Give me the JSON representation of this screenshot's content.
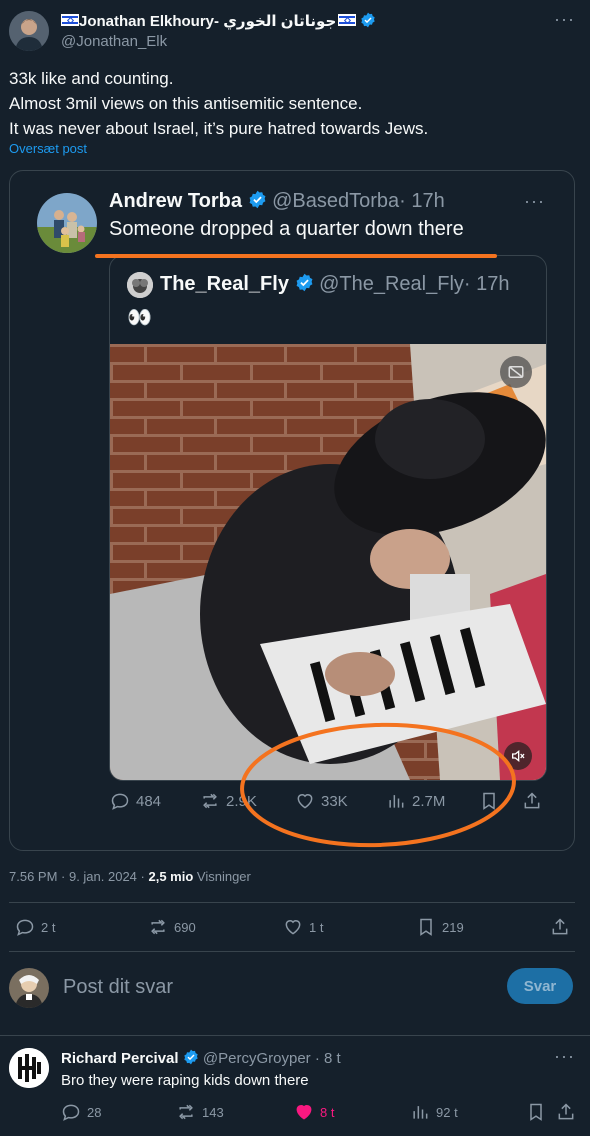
{
  "main_post": {
    "author_name": "Jonathan Elkhoury- جوناتان الخوري",
    "handle": "@Jonathan_Elk",
    "text_lines": [
      "33k like and counting.",
      "Almost 3mil views on this antisemitic sentence.",
      "It was never about Israel, it’s pure hatred towards Jews."
    ],
    "translate_label": "Oversæt post",
    "meta_time": "7.56 PM · 9. jan. 2024 ·",
    "meta_views_count": "2,5 mio",
    "meta_views_label": "Visninger",
    "actions": {
      "replies": "2 t",
      "reposts": "690",
      "likes": "1 t",
      "bookmarks": "219"
    }
  },
  "quoted_post": {
    "author_name": "Andrew Torba",
    "handle": "@BasedTorba",
    "time": "· 17h",
    "text": "Someone dropped a quarter down there",
    "inner_quote": {
      "author_name": "The_Real_Fly",
      "handle": "@The_Real_Fly",
      "time": "· 17h",
      "text": "👀"
    },
    "actions": {
      "replies": "484",
      "reposts": "2.9K",
      "likes": "33K",
      "views": "2.7M"
    }
  },
  "reply_box": {
    "placeholder": "Post dit svar",
    "button_label": "Svar"
  },
  "reply": {
    "author_name": "Richard Percival",
    "handle": "@PercyGroyper",
    "time": "· 8 t",
    "text": "Bro they were raping kids down there",
    "actions": {
      "replies": "28",
      "reposts": "143",
      "likes": "8 t",
      "views": "92 t"
    }
  },
  "colors": {
    "background": "#15202b",
    "accent": "#1d9bf0",
    "annotation": "#f4731f",
    "like_pink": "#f91880"
  }
}
